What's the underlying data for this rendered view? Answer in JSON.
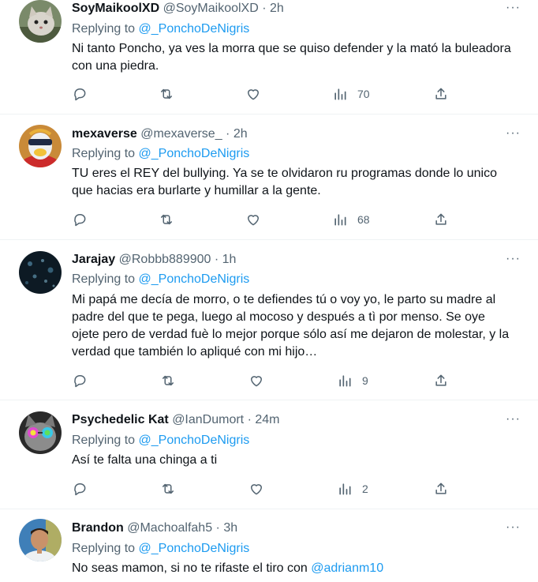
{
  "tweets": [
    {
      "name": "SoyMaikoolXD",
      "handle": "@SoyMaikoolXD",
      "time": "2h",
      "replying_prefix": "Replying to",
      "replying_to": "@_PonchoDeNigris",
      "text": "Ni tanto Poncho, ya ves la morra que se quiso defender y la mató la buleadora con una piedra.",
      "views": "70",
      "avatar": "cat-photo"
    },
    {
      "name": "mexaverse",
      "handle": "@mexaverse_",
      "time": "2h",
      "replying_prefix": "Replying to",
      "replying_to": "@_PonchoDeNigris",
      "text": "TU eres el REY del bullying. Ya se te olvidaron ru programas donde lo unico que hacias era burlarte y humillar a la gente.",
      "views": "68",
      "avatar": "3d-character"
    },
    {
      "name": "Jarajay",
      "handle": "@Robbb889900",
      "time": "1h",
      "replying_prefix": "Replying to",
      "replying_to": "@_PonchoDeNigris",
      "text": "Mi papá me decía de morro, o te defiendes tú o voy yo, le parto su madre al padre del que te pega, luego al mocoso y después a tì por menso. Se oye ojete pero de verdad fuè lo mejor porque sólo así me dejaron de molestar, y la verdad que también lo apliqué con mi hijo…",
      "views": "9",
      "avatar": "dark-bokeh"
    },
    {
      "name": "Psychedelic Kat",
      "handle": "@IanDumort",
      "time": "24m",
      "replying_prefix": "Replying to",
      "replying_to": "@_PonchoDeNigris",
      "text": "Así te falta una chinga a ti",
      "views": "2",
      "avatar": "cat-sunglasses"
    },
    {
      "name": "Brandon",
      "handle": "@Machoalfah5",
      "time": "3h",
      "replying_prefix": "Replying to",
      "replying_to": "@_PonchoDeNigris",
      "text": "No seas mamon, si no te rifaste el tiro con",
      "text_mention": "@adrianm10",
      "avatar": "man-portrait"
    }
  ],
  "separator": "·",
  "more_label": "···",
  "colors": {
    "accent": "#1d9bf0",
    "muted": "#536471",
    "text": "#0f1419",
    "border": "#eff3f4"
  },
  "icons": [
    "reply-icon",
    "retweet-icon",
    "like-icon",
    "views-icon",
    "share-icon",
    "more-icon"
  ]
}
